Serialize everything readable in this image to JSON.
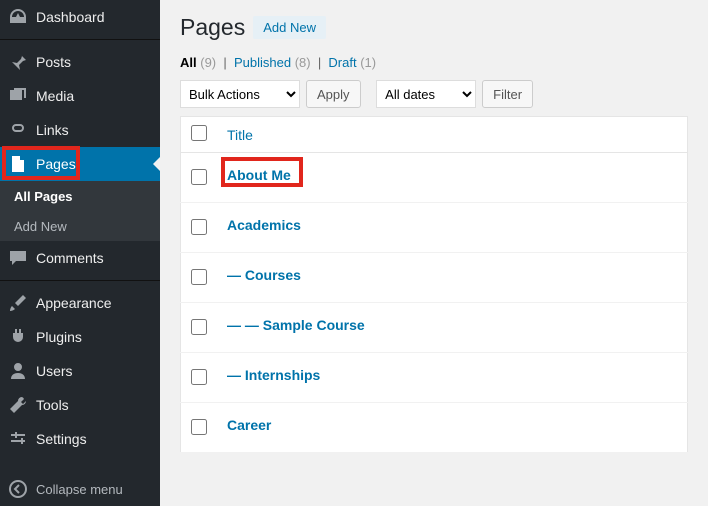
{
  "sidebar": {
    "items": [
      {
        "label": "Dashboard"
      },
      {
        "label": "Posts"
      },
      {
        "label": "Media"
      },
      {
        "label": "Links"
      },
      {
        "label": "Pages"
      },
      {
        "label": "Comments"
      },
      {
        "label": "Appearance"
      },
      {
        "label": "Plugins"
      },
      {
        "label": "Users"
      },
      {
        "label": "Tools"
      },
      {
        "label": "Settings"
      }
    ],
    "submenu": {
      "all_pages": "All Pages",
      "add_new": "Add New"
    },
    "collapse": "Collapse menu"
  },
  "header": {
    "title": "Pages",
    "add_new": "Add New"
  },
  "filters": {
    "all_label": "All",
    "all_count": "(9)",
    "published_label": "Published",
    "published_count": "(8)",
    "draft_label": "Draft",
    "draft_count": "(1)",
    "bulk_actions": "Bulk Actions",
    "apply": "Apply",
    "all_dates": "All dates",
    "filter": "Filter"
  },
  "table": {
    "col_title": "Title",
    "rows": [
      {
        "title": "About Me"
      },
      {
        "title": "Academics"
      },
      {
        "title": "— Courses"
      },
      {
        "title": "— — Sample Course"
      },
      {
        "title": "— Internships"
      },
      {
        "title": "Career"
      }
    ]
  }
}
